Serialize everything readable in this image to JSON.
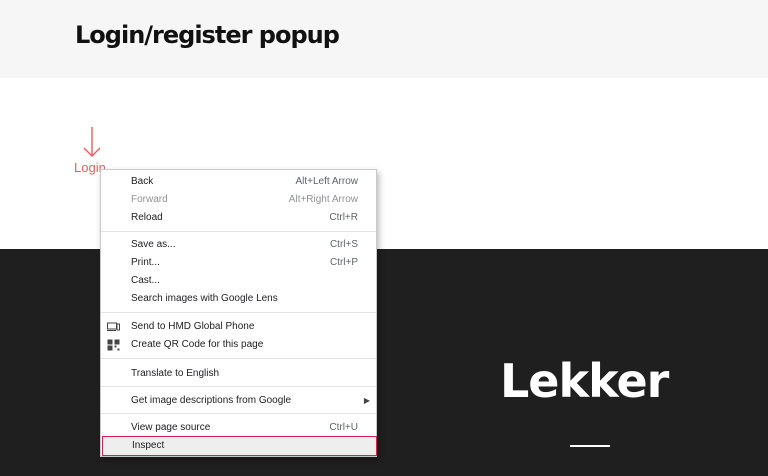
{
  "page": {
    "title": "Login/register popup",
    "login_link": "Login",
    "brand": "Lekker"
  },
  "context_menu": {
    "items": [
      {
        "label": "Back",
        "shortcut": "Alt+Left Arrow",
        "disabled": false
      },
      {
        "label": "Forward",
        "shortcut": "Alt+Right Arrow",
        "disabled": true
      },
      {
        "label": "Reload",
        "shortcut": "Ctrl+R",
        "disabled": false
      },
      {
        "label": "Save as...",
        "shortcut": "Ctrl+S",
        "disabled": false
      },
      {
        "label": "Print...",
        "shortcut": "Ctrl+P",
        "disabled": false
      },
      {
        "label": "Cast...",
        "shortcut": "",
        "disabled": false
      },
      {
        "label": "Search images with Google Lens",
        "shortcut": "",
        "disabled": false
      },
      {
        "label": "Send to HMD Global Phone",
        "shortcut": "",
        "icon": "device-icon",
        "disabled": false
      },
      {
        "label": "Create QR Code for this page",
        "shortcut": "",
        "icon": "qr-code-icon",
        "disabled": false
      },
      {
        "label": "Translate to English",
        "shortcut": "",
        "disabled": false
      },
      {
        "label": "Get image descriptions from Google",
        "shortcut": "",
        "submenu": true,
        "disabled": false
      },
      {
        "label": "View page source",
        "shortcut": "Ctrl+U",
        "disabled": false
      },
      {
        "label": "Inspect",
        "shortcut": "",
        "highlighted": true,
        "disabled": false
      }
    ]
  },
  "colors": {
    "accent": "#ec5b5b",
    "dark_section": "#1f1f1f",
    "header_band": "#f6f6f6",
    "highlight_border": "#d6224a"
  }
}
